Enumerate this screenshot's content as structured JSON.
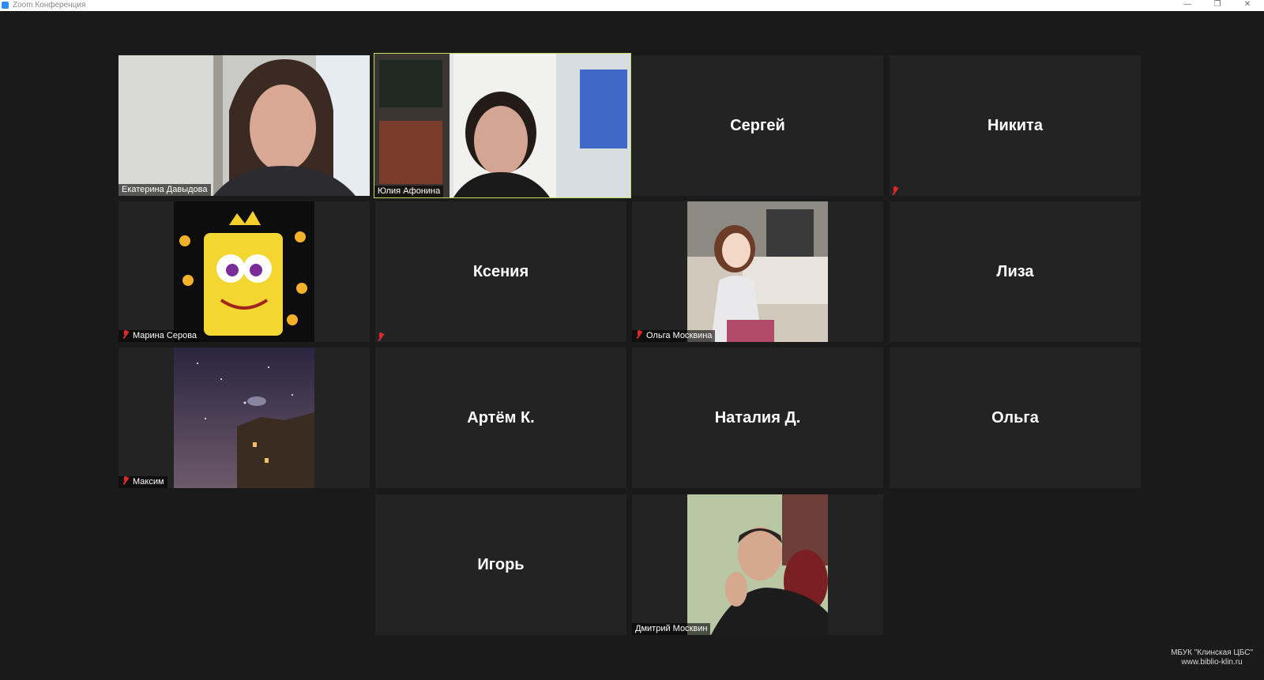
{
  "window": {
    "title": "Zoom Конференция",
    "controls": {
      "minimize": "—",
      "restore": "❐",
      "close": "✕"
    }
  },
  "participants": {
    "t1": {
      "name": "Екатерина Давыдова",
      "video": "woman-portrait-window-background"
    },
    "t2": {
      "name": "Юлия Афонина",
      "video": "woman-headset-bookshelf-background",
      "active_speaker": true
    },
    "t3": {
      "name": "Сергей"
    },
    "t4": {
      "name": "Никита",
      "muted": true
    },
    "t5": {
      "name": "Марина Серова",
      "muted": true,
      "video": "cartoon-sponge-hearts-picture"
    },
    "t6": {
      "name": "Ксения",
      "muted": true
    },
    "t7": {
      "name": "Ольга Москвина",
      "muted": true,
      "video": "anime-girl-at-desk-picture"
    },
    "t8": {
      "name": "Лиза"
    },
    "t9": {
      "name": "Максим",
      "muted": true,
      "video": "night-sky-building-picture"
    },
    "t10": {
      "name": "Артём К."
    },
    "t11": {
      "name": "Наталия Д."
    },
    "t12": {
      "name": "Ольга"
    },
    "t13": {
      "name": "Игорь"
    },
    "t14": {
      "name": "Дмитрий Москвин",
      "video": "man-portrait-photo"
    }
  },
  "watermark": {
    "line1": "МБУК \"Клинская ЦБС\"",
    "line2": "www.biblio-klin.ru"
  },
  "colors": {
    "background": "#1a1a1a",
    "tile": "#232323",
    "active_speaker_border": "#c4de58",
    "muted_icon": "#e02828"
  }
}
